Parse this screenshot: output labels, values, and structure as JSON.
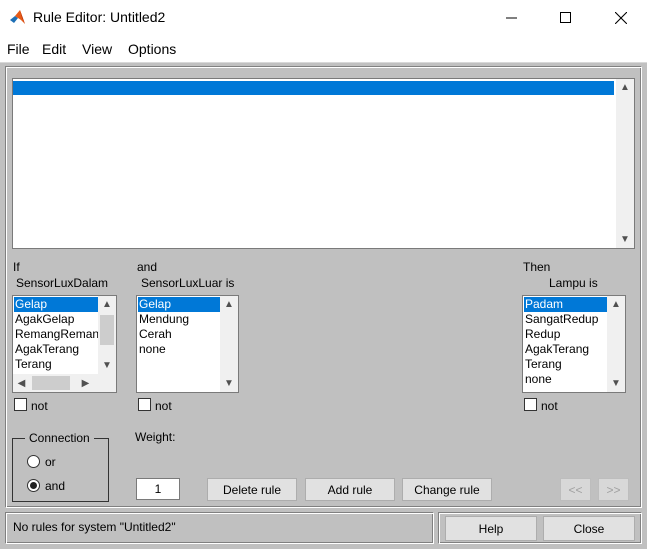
{
  "window": {
    "title": "Rule Editor: Untitled2"
  },
  "menu": [
    "File",
    "Edit",
    "View",
    "Options"
  ],
  "inputs": [
    {
      "prefix": "If",
      "variable": "SensorLuxDalam",
      "options": [
        "Gelap",
        "AgakGelap",
        "RemangReman",
        "AgakTerang",
        "Terang"
      ],
      "selected": 0,
      "not_label": "not"
    },
    {
      "prefix": "and",
      "variable": "SensorLuxLuar is",
      "options": [
        "Gelap",
        "Mendung",
        "Cerah",
        "none"
      ],
      "selected": 0,
      "not_label": "not"
    }
  ],
  "output": {
    "prefix": "Then",
    "variable": "Lampu is",
    "options": [
      "Padam",
      "SangatRedup",
      "Redup",
      "AgakTerang",
      "Terang",
      "none"
    ],
    "selected": 0,
    "not_label": "not"
  },
  "connection": {
    "title": "Connection",
    "options": [
      "or",
      "and"
    ],
    "selected": "and"
  },
  "weight": {
    "label": "Weight:",
    "value": "1"
  },
  "buttons": {
    "delete_rule": "Delete rule",
    "add_rule": "Add rule",
    "change_rule": "Change rule",
    "prev": "<<",
    "next": ">>",
    "help": "Help",
    "close": "Close"
  },
  "status": "No rules for system \"Untitled2\"",
  "colors": {
    "selection": "#0078d7",
    "panel": "#c0c0c0",
    "titlebar": "#ffffff"
  }
}
